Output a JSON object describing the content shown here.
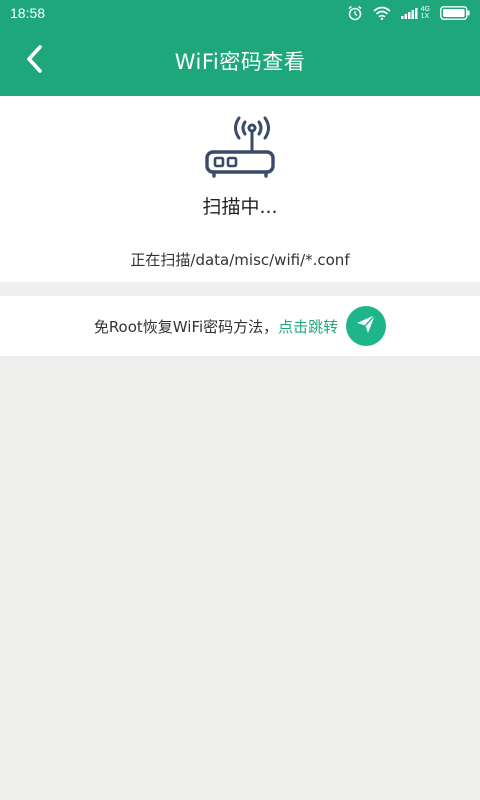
{
  "statusbar": {
    "time": "18:58",
    "net_top": "4G",
    "net_bottom": "1X",
    "icons": [
      "alarm-icon",
      "wifi-signal-icon",
      "cell-signal-icon",
      "battery-icon"
    ]
  },
  "header": {
    "title": "WiFi密码查看",
    "back_icon": "chevron-left-icon"
  },
  "scan": {
    "icon": "router-icon",
    "status": "扫描中...",
    "path": "正在扫描/data/misc/wifi/*.conf"
  },
  "link": {
    "text": "免Root恢复WiFi密码方法，",
    "action": "点击跳转",
    "icon": "paper-plane-icon"
  },
  "colors": {
    "header": "#1fa77c",
    "accent": "#1fa77c",
    "icon_dark": "#3a4a6b",
    "background": "#efefed"
  }
}
